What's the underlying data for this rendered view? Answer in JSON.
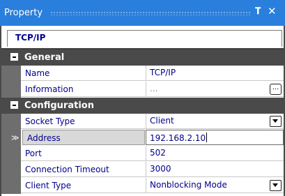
{
  "window": {
    "title": "Property",
    "pin_glyph": "❙",
    "close_glyph": "✕"
  },
  "object_name": "TCP/IP",
  "categories": [
    {
      "label": "General",
      "expander": "−",
      "properties": [
        {
          "name": "Name",
          "value": "TCP/IP"
        },
        {
          "name": "Information",
          "value": "...",
          "button": "..."
        }
      ]
    },
    {
      "label": "Configuration",
      "expander": "−",
      "properties": [
        {
          "name": "Socket Type",
          "value": "Client"
        },
        {
          "name": "Address",
          "value": "192.168.2.10",
          "selected_marker": "≫"
        },
        {
          "name": "Port",
          "value": "502"
        },
        {
          "name": "Connection Timeout",
          "value": "3000"
        },
        {
          "name": "Client Type",
          "value": "Nonblocking Mode"
        }
      ]
    }
  ],
  "colors": {
    "titlebar": "#2a7fdc",
    "category_bg": "#4a4a4a",
    "property_text": "#00008b"
  }
}
